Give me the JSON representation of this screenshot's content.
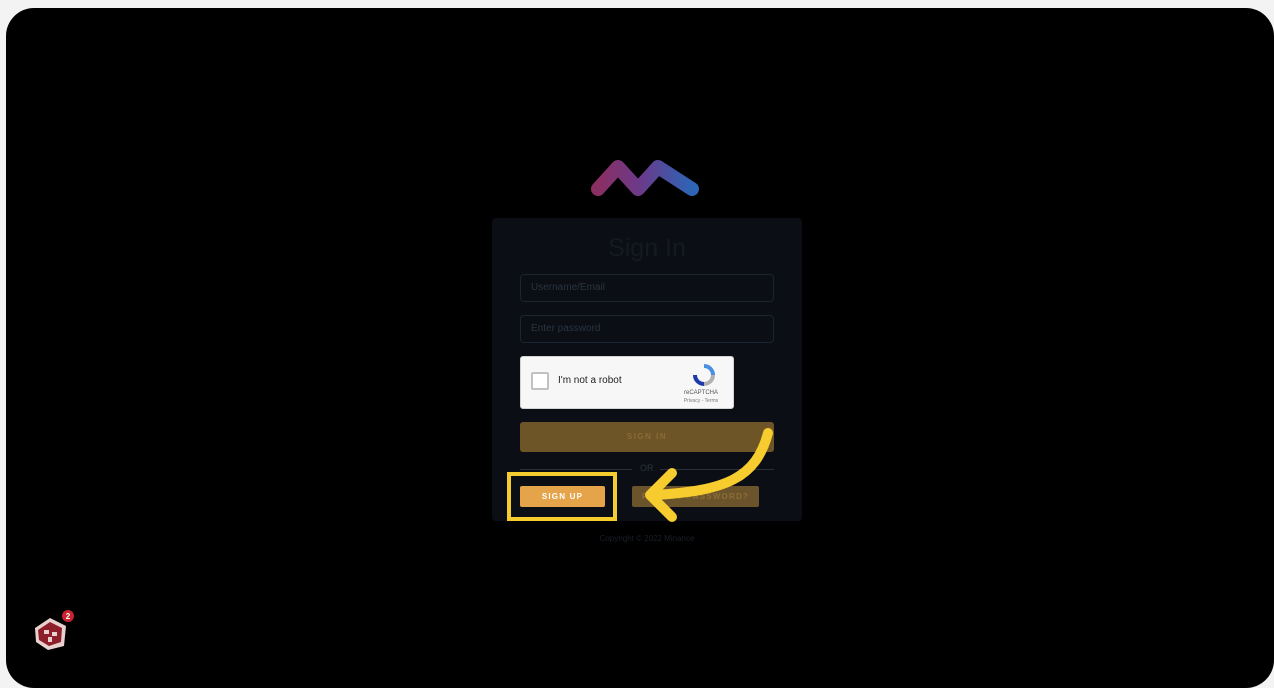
{
  "login": {
    "title": "Sign In",
    "username_placeholder": "Username/Email",
    "password_placeholder": "Enter password",
    "captcha": {
      "label": "I'm not a robot",
      "brand": "reCAPTCHA",
      "terms": "Privacy - Terms"
    },
    "sign_in_label": "SIGN IN",
    "or_label": "OR",
    "sign_up_label": "SIGN UP",
    "forgot_label": "FORGOT PASSWORD?"
  },
  "footer": {
    "copyright": "Copyright © 2022 Minance"
  },
  "overlay": {
    "highlight_color": "#f6cc2e",
    "badge_count": "2"
  },
  "colors": {
    "accent": "#e6a44a",
    "background": "#000000"
  }
}
